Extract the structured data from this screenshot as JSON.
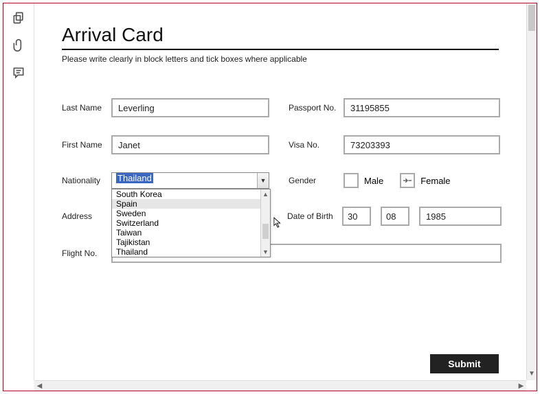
{
  "title": "Arrival Card",
  "subtitle": "Please write clearly in block letters and tick boxes where applicable",
  "labels": {
    "last_name": "Last Name",
    "first_name": "First Name",
    "nationality": "Nationality",
    "address": "Address",
    "flight_no": "Flight No.",
    "passport_no": "Passport No.",
    "visa_no": "Visa No.",
    "gender": "Gender",
    "male": "Male",
    "female": "Female",
    "date_of_birth": "Date of Birth",
    "submit": "Submit"
  },
  "values": {
    "last_name": "Leverling",
    "first_name": "Janet",
    "nationality_selected": "Thailand",
    "passport_no": "31195855",
    "visa_no": "73203393",
    "dob_day": "30",
    "dob_month": "08",
    "dob_year": "1985",
    "address": "",
    "flight_no": ""
  },
  "dropdown": {
    "options": [
      "South Korea",
      "Spain",
      "Sweden",
      "Switzerland",
      "Taiwan",
      "Tajikistan",
      "Thailand"
    ],
    "hovered_index": 1
  },
  "gender": {
    "male": false,
    "female": false
  }
}
